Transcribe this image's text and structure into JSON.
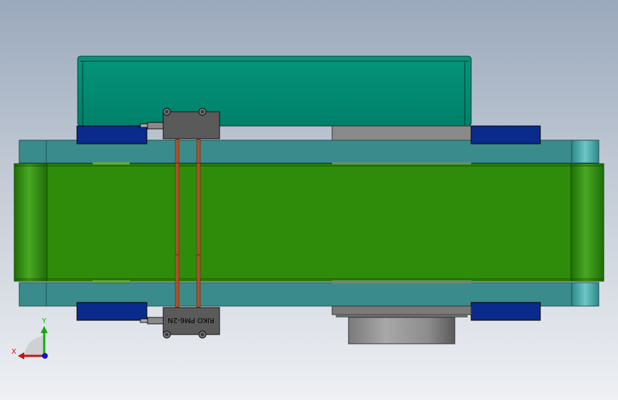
{
  "sensor": {
    "model_label": "RIKO PM6-2N"
  },
  "triad": {
    "x_label": "X",
    "y_label": "Y"
  },
  "colors": {
    "hopper": "#008a6e",
    "frame_rail": "#3a8c8c",
    "belt": "#2e8c0a",
    "belt_edge": "#1f6a05",
    "sensor_body": "#5a5a5a",
    "blue_block": "#0a2a8c",
    "wire": "#b0502a",
    "motor": "#8a8a8a",
    "axis_x": "#cc1111",
    "axis_y": "#11aa11",
    "axis_z": "#1111cc"
  }
}
